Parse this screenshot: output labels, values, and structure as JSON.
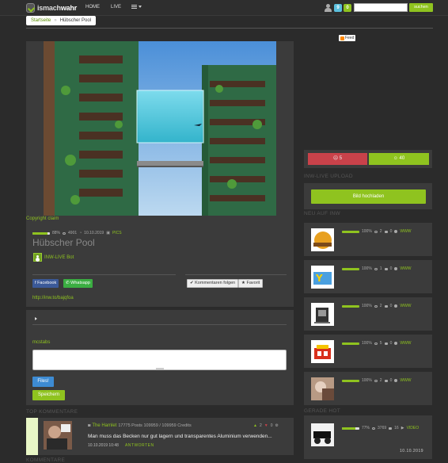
{
  "nav": {
    "logo_text_a": "ismach",
    "logo_text_b": "wahr",
    "home": "HOME",
    "live": "LIVE",
    "badge_messages": "9",
    "badge_notifications": "0",
    "search_button": "suchen",
    "badge_colors": {
      "messages": "#5bc0de",
      "notifications": "#8fc31f"
    }
  },
  "breadcrumb": {
    "home": "Startseite",
    "separator": "»",
    "current": "Hübscher Pool"
  },
  "post": {
    "copyright": "Copyright claim",
    "progress_percent": 88,
    "progress_label": "88%",
    "views": "4901",
    "date": "10.10.2019",
    "type": "PICS",
    "title": "Hübscher Pool",
    "author": "INW-LIVE Bot",
    "short_url": "http://inw.to/bajqfoa"
  },
  "share": {
    "facebook": "Facebook",
    "whatsapp": "Whatsapp",
    "follow": "Kommentaren folgen",
    "favorite": "Favorit"
  },
  "comment_form": {
    "mention": "mcstabs",
    "files": "Files!",
    "save": "Speichern"
  },
  "top_comments": {
    "heading": "TOP KOMMENTARE",
    "items": [
      {
        "user": "The Hamlet",
        "stats": "17775 Posts 109959 / 109959 Credits",
        "text": "Man muss das Becken nur gut lagern und transparentes Aluminium verwenden...",
        "time": "10.10.2019 10:48",
        "reply": "ANTWORTEN",
        "up": "2",
        "down": "0"
      }
    ]
  },
  "comments_heading": "KOMMENTARE",
  "sidebar": {
    "feed": "Feed",
    "votes_down": "5",
    "votes_up": "40",
    "upload_heading": "INW-LIVE UPLOAD",
    "upload_button": "Bild hochladen",
    "new_heading": "NEU AUF INW",
    "new_items": [
      {
        "percent": 100,
        "percent_label": "100%",
        "views": "2",
        "comments": "0",
        "link": "WWW"
      },
      {
        "percent": 100,
        "percent_label": "100%",
        "views": "1",
        "comments": "0",
        "link": "WWW"
      },
      {
        "percent": 100,
        "percent_label": "100%",
        "views": "2",
        "comments": "0",
        "link": "WWW"
      },
      {
        "percent": 100,
        "percent_label": "100%",
        "views": "5",
        "comments": "0",
        "link": "WWW"
      },
      {
        "percent": 100,
        "percent_label": "100%",
        "views": "2",
        "comments": "0",
        "link": "WWW"
      }
    ],
    "hot_heading": "GERADE HOT",
    "hot_item": {
      "percent": 77,
      "percent_label": "77%",
      "views": "3769",
      "comments": "16",
      "type": "VIDEO",
      "date": "10.10.2019"
    }
  }
}
